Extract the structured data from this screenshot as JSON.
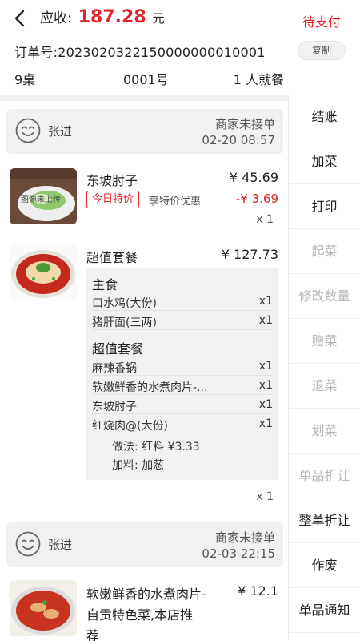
{
  "header": {
    "receivable_label": "应收:",
    "amount": "187.28",
    "unit": "元",
    "status": "待支付"
  },
  "order": {
    "number": "订单号:2023020322150000000010001",
    "copy_label": "复制",
    "table": "9桌",
    "serial": "0001号",
    "diners": "1 人就餐"
  },
  "groups": [
    {
      "name": "张进",
      "status": "商家未接单",
      "time": "02-20 08:57",
      "items": [
        {
          "name": "东坡肘子",
          "price": "¥ 45.69",
          "tag": "今日特价",
          "tag_desc": "享特价优惠",
          "discount": "-¥ 3.69",
          "qty": "x 1",
          "image_caption": "图像未上传"
        },
        {
          "name": "超值套餐",
          "price": "¥ 127.73",
          "qty": "x 1",
          "sections": [
            {
              "title": "主食",
              "lines": [
                {
                  "name": "口水鸡(大份)",
                  "qty": "x1"
                },
                {
                  "name": "猪肝面(三两)",
                  "qty": "x1"
                }
              ]
            },
            {
              "title": "超值套餐",
              "lines": [
                {
                  "name": "麻辣香锅",
                  "qty": "x1"
                },
                {
                  "name": "软嫩鲜香的水煮肉片-...",
                  "qty": "x1"
                },
                {
                  "name": "东坡肘子",
                  "qty": "x1"
                },
                {
                  "name": "红烧肉@(大份)",
                  "qty": "x1"
                }
              ]
            }
          ],
          "method": "做法: 红料 ¥3.33",
          "addon": "加料: 加葱"
        }
      ]
    },
    {
      "name": "张进",
      "status": "商家未接单",
      "time": "02-03 22:15",
      "items": [
        {
          "name_line1": "软嫩鲜香的水煮肉片-",
          "name_line2": "自贡特色菜,本店推",
          "name_line3": "荐",
          "price": "¥ 12.1"
        }
      ]
    }
  ],
  "side_menu": [
    {
      "label": "结账",
      "enabled": true
    },
    {
      "label": "加菜",
      "enabled": true
    },
    {
      "label": "打印",
      "enabled": true
    },
    {
      "label": "起菜",
      "enabled": false
    },
    {
      "label": "修改数量",
      "enabled": false
    },
    {
      "label": "赠菜",
      "enabled": false
    },
    {
      "label": "退菜",
      "enabled": false
    },
    {
      "label": "划菜",
      "enabled": false
    },
    {
      "label": "单品折让",
      "enabled": false
    },
    {
      "label": "整单折让",
      "enabled": true
    },
    {
      "label": "作废",
      "enabled": true
    },
    {
      "label": "单品通知",
      "enabled": true
    }
  ],
  "colors": {
    "accent": "#e2252c",
    "disabled": "#b8b8b8",
    "panel": "#f1f1f1"
  }
}
